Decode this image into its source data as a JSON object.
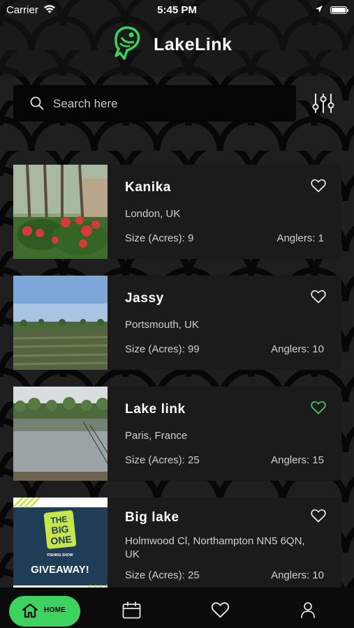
{
  "status_bar": {
    "carrier": "Carrier",
    "time": "5:45 PM"
  },
  "app": {
    "title": "LakeLink",
    "accent": "#3ed35f"
  },
  "search": {
    "placeholder": "Search here"
  },
  "lakes": [
    {
      "name": "Kanika",
      "location": "London, UK",
      "size": "Size (Acres): 9",
      "anglers": "Anglers: 1",
      "favorite": false,
      "image": "flowers-photo"
    },
    {
      "name": "Jassy",
      "location": "Portsmouth, UK",
      "size": "Size (Acres): 99",
      "anglers": "Anglers: 10",
      "favorite": false,
      "image": "field-photo"
    },
    {
      "name": "Lake link",
      "location": "Paris, France",
      "size": "Size (Acres): 25",
      "anglers": "Anglers: 15",
      "favorite": true,
      "image": "lake-photo"
    },
    {
      "name": "Big lake",
      "location": "Holmwood Cl, Northampton NN5 6QN, UK",
      "size": "Size (Acres): 25",
      "anglers": "Anglers: 10",
      "favorite": false,
      "image": "giveaway-poster",
      "poster": {
        "line1": "THE",
        "line2": "BIG",
        "line3": "ONE",
        "subtitle": "FISHING SHOW",
        "cta": "GIVEAWAY!"
      }
    }
  ],
  "tabbar": {
    "home_label": "HOME",
    "tabs": [
      "home-tab",
      "calendar-tab",
      "favorites-tab",
      "profile-tab"
    ]
  }
}
